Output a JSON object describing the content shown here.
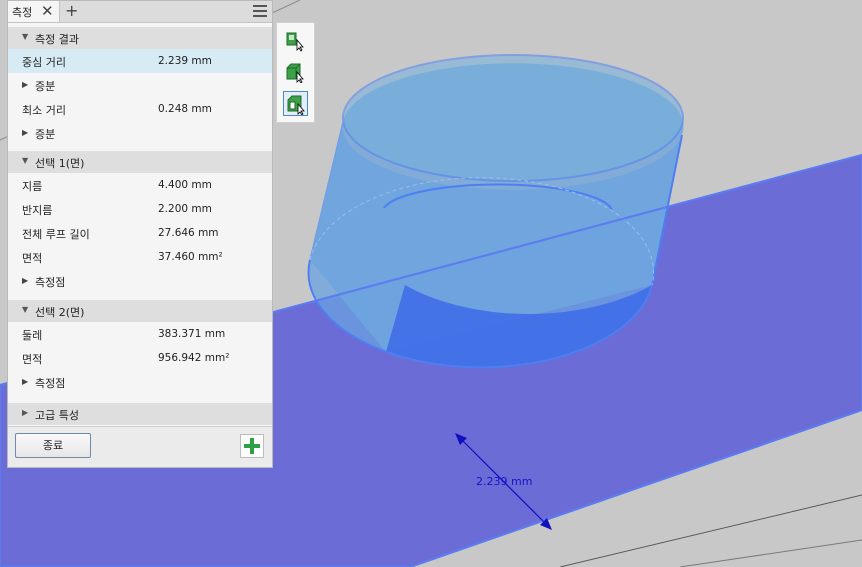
{
  "panel": {
    "tab_label": "측정",
    "result_header": "측정 결과",
    "rows_result": [
      {
        "label": "중심 거리",
        "value": "2.239 mm"
      },
      {
        "sub": "증분"
      },
      {
        "label": "최소 거리",
        "value": "0.248 mm"
      },
      {
        "sub": "증분"
      }
    ],
    "sel1_header": "선택 1(면)",
    "rows_sel1": [
      {
        "label": "지름",
        "value": "4.400 mm"
      },
      {
        "label": "반지름",
        "value": "2.200 mm"
      },
      {
        "label": "전체 루프 길이",
        "value": "27.646 mm"
      },
      {
        "label": "면적",
        "value": "37.460 mm²"
      },
      {
        "sub": "측정점"
      }
    ],
    "sel2_header": "선택 2(면)",
    "rows_sel2": [
      {
        "label": "둘레",
        "value": "383.371 mm"
      },
      {
        "label": "면적",
        "value": "956.942 mm²"
      },
      {
        "sub": "측정점"
      }
    ],
    "advanced_header": "고급 특성",
    "close_label": "종료"
  },
  "viewport": {
    "dimension_label": "2.239 mm"
  },
  "toolbar": {
    "tools": [
      "select-face-icon",
      "select-body-icon",
      "select-part-icon"
    ],
    "active_index": 2
  },
  "colors": {
    "plane": "#6c6cd6",
    "cylinder": "#5a98dd",
    "highlight_edge": "#4e7ff2",
    "selected_row": "#d6ebf3",
    "add_icon": "#2da043"
  }
}
